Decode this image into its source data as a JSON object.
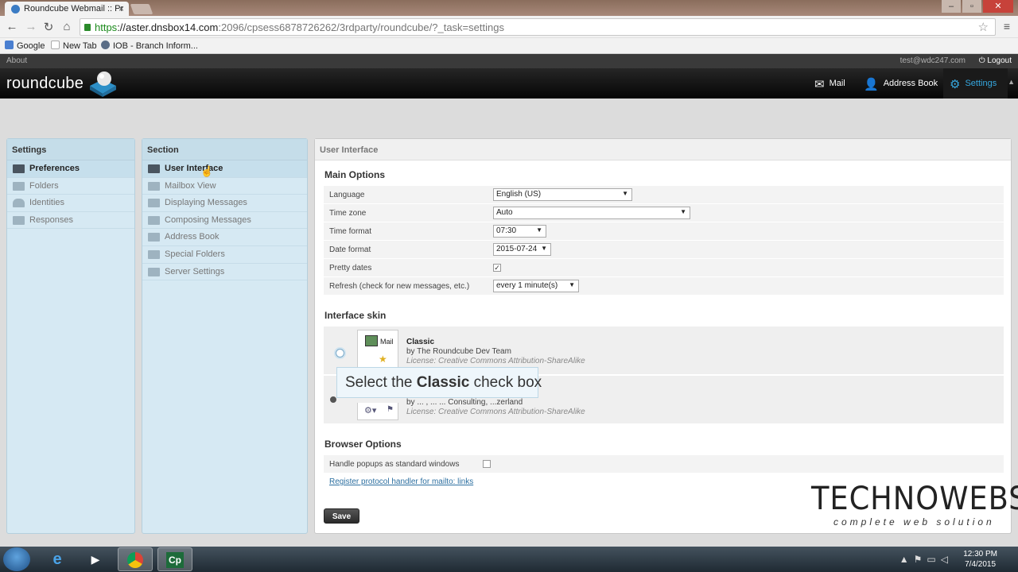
{
  "browser": {
    "tab_title": "Roundcube Webmail :: Pr",
    "url_scheme": "https",
    "url_host": "://aster.dnsbox14.com",
    "url_rest": ":2096/cpsess6878726262/3rdparty/roundcube/?_task=settings",
    "bookmarks": [
      "Google",
      "New Tab",
      "IOB - Branch Inform..."
    ]
  },
  "topbar": {
    "about": "About",
    "user": "test@wdc247.com",
    "logout": "Logout"
  },
  "header": {
    "logo": "roundcube",
    "nav": [
      {
        "label": "Mail",
        "icon": "envelope-icon"
      },
      {
        "label": "Address Book",
        "icon": "person-icon"
      },
      {
        "label": "Settings",
        "icon": "gear-icon"
      }
    ]
  },
  "settings_panel": {
    "title": "Settings",
    "items": [
      "Preferences",
      "Folders",
      "Identities",
      "Responses"
    ]
  },
  "section_panel": {
    "title": "Section",
    "items": [
      "User Interface",
      "Mailbox View",
      "Displaying Messages",
      "Composing Messages",
      "Address Book",
      "Special Folders",
      "Server Settings"
    ]
  },
  "main": {
    "title": "User Interface",
    "main_options_title": "Main Options",
    "options": [
      {
        "label": "Language",
        "value": "English (US)"
      },
      {
        "label": "Time zone",
        "value": "Auto"
      },
      {
        "label": "Time format",
        "value": "07:30"
      },
      {
        "label": "Date format",
        "value": "2015-07-24"
      },
      {
        "label": "Pretty dates",
        "value": "checked"
      },
      {
        "label": "Refresh (check for new messages, etc.)",
        "value": "every 1 minute(s)"
      }
    ],
    "skin_title": "Interface skin",
    "skins": [
      {
        "name": "Classic",
        "by": "by The Roundcube Dev Team",
        "license": "License: Creative Commons Attribution-ShareAlike",
        "thumb_label": "Mail"
      },
      {
        "name": "",
        "by": "by ... , ... ... Consulting, ...zerland",
        "license": "License: Creative Commons Attribution-ShareAlike",
        "thumb_label": ""
      }
    ],
    "tooltip_pre": "Select the ",
    "tooltip_bold": "Classic",
    "tooltip_post": " check box",
    "browser_title": "Browser Options",
    "popup_label": "Handle popups as standard windows",
    "protocol_link": "Register protocol handler for mailto: links",
    "save": "Save"
  },
  "watermark": {
    "main": "TECHNOWEBSY",
    "sub": "complete web solution"
  },
  "taskbar": {
    "time": "12:30 PM",
    "date": "7/4/2015"
  }
}
